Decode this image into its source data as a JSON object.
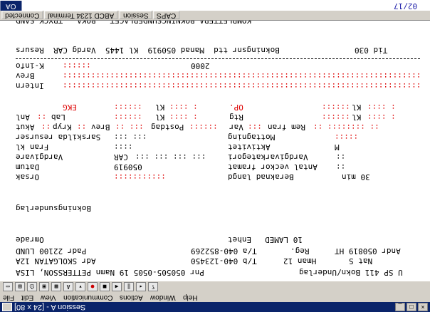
{
  "window": {
    "title": "Session A - [24 x 80]"
  },
  "menu": [
    "File",
    "Edit",
    "View",
    "Communication",
    "Actions",
    "Window",
    "Help"
  ],
  "header": {
    "code": "OA",
    "page": "02/17"
  },
  "screen_title": "KOMPLETTERA BOKNINGSUNDERLAGET - BOKA - TRYCK SAND",
  "summary": {
    "text": "Bokningsnr ttd  Manad 050919  Kl 1445  Vardg CAR  Resurs",
    "tid": "Tid 030"
  },
  "labels": {
    "kinfo": "K-info",
    "brev": "Brev",
    "intern": "Intern",
    "anl": "Anl",
    "akut": "Akut",
    "sarskilda": "Sarskilda resurser",
    "fran_kl": "Fran kl",
    "vardgivare": "Vardgivare",
    "datum": "Datum",
    "orsak": "Orsak",
    "bokningsunderlag": "Bokningsunderlag",
    "omrade": "Omrade",
    "enhet": "Enhet",
    "lamed": "10 LAMED",
    "lab": "Lab",
    "rtg": "Rtg",
    "kl": "Kl",
    "ekg": "EKG",
    "op": "OP.",
    "kryp": "Kryp",
    "brev2": "Brev",
    "postdag": "Postdag",
    "var": "Var",
    "rem_fran": "Rem fran",
    "mottagning": "Mottagning",
    "aktivitet": "Aktivitet",
    "vardgivarkategori": "Vardgivarkategori",
    "antal_veckor": "Antal veckor framat",
    "beraknad": "Beraknad langd",
    "minutes": "30 min",
    "kinfo_val": "2000",
    "vardgivare_val": "CAR",
    "datum_val": "050919",
    "aktivitet_val": "M"
  },
  "patient": {
    "pnr": "Pnr 050505-0505 19 Namn PETTERSSON, LISA",
    "adr": "Adr SKOLGATAN 12A",
    "padr": "Padr 22100 LUND",
    "tel1": "T/b 040-123450",
    "tel2": "T/a 040-852269",
    "hman": "Hman 12",
    "nat": "Nat S",
    "reg": "Reg.",
    "andr": "Andr 050819 HT",
    "ref": "U SP 411 Bokn/Underlag"
  },
  "status_tabs": [
    "Connected",
    "ABCD 1234 Terminal",
    "Session",
    "CAPS"
  ]
}
